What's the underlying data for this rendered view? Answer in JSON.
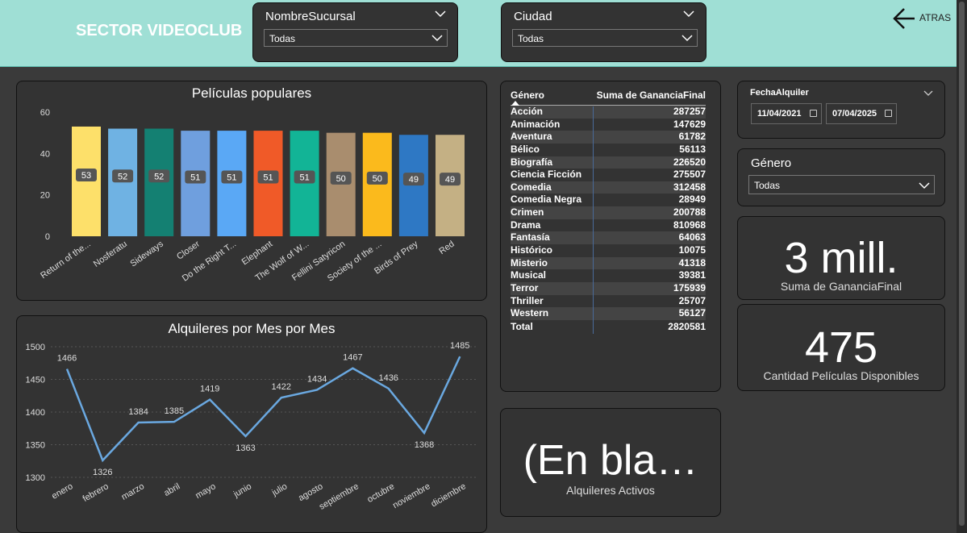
{
  "header": {
    "title": "SECTOR VIDEOCLUB",
    "back_label": "ATRAS"
  },
  "slicers": {
    "sucursal": {
      "label": "NombreSucursal",
      "value": "Todas"
    },
    "ciudad": {
      "label": "Ciudad",
      "value": "Todas"
    },
    "fecha": {
      "label": "FechaAlquiler",
      "start": "11/04/2021",
      "end": "07/04/2025"
    },
    "genero": {
      "label": "Género",
      "value": "Todas"
    }
  },
  "chart_data": [
    {
      "type": "bar",
      "title": "Películas populares",
      "categories": [
        "Return of the...",
        "Nosferatu",
        "Sideways",
        "Closer",
        "Do the Right T...",
        "Elephant",
        "The Wolf of W...",
        "Fellini Satyricon",
        "Society of the ...",
        "Birds of Prey",
        "Red"
      ],
      "values": [
        53,
        52,
        52,
        51,
        51,
        51,
        51,
        50,
        50,
        49,
        49
      ],
      "value_labels": [
        "53",
        "52",
        "52",
        "51",
        "51",
        "51",
        "51",
        "50",
        "50",
        "49",
        "49"
      ],
      "colors": [
        "#fde06a",
        "#6fb2e3",
        "#148072",
        "#6f9fde",
        "#5aa8f5",
        "#f05a28",
        "#12b496",
        "#a98d6e",
        "#fbba1c",
        "#2e78c4",
        "#c4b084"
      ],
      "ylim": [
        0,
        60
      ],
      "yticks": [
        "0",
        "20",
        "40",
        "60"
      ],
      "grid": false
    },
    {
      "type": "line",
      "title": "Alquileres por Mes por Mes",
      "categories": [
        "enero",
        "febrero",
        "marzo",
        "abril",
        "mayo",
        "junio",
        "julio",
        "agosto",
        "septiembre",
        "octubre",
        "noviembre",
        "diciembre"
      ],
      "values": [
        1466,
        1326,
        1384,
        1385,
        1419,
        1363,
        1422,
        1434,
        1467,
        1436,
        1368,
        1485
      ],
      "value_labels": [
        "1466",
        "1326",
        "1384",
        "1385",
        "1419",
        "1363",
        "1422",
        "1434",
        "1467",
        "1436",
        "1368",
        "1485"
      ],
      "ylim": [
        1300,
        1500
      ],
      "yticks": [
        "1300",
        "1350",
        "1400",
        "1450",
        "1500"
      ],
      "color": "#6aa8e0",
      "grid": true
    }
  ],
  "table": {
    "col1": "Género",
    "col2": "Suma de GananciaFinal",
    "rows": [
      {
        "genre": "Acción",
        "value": "287257"
      },
      {
        "genre": "Animación",
        "value": "147629"
      },
      {
        "genre": "Aventura",
        "value": "61782"
      },
      {
        "genre": "Bélico",
        "value": "56113"
      },
      {
        "genre": "Biografía",
        "value": "226520"
      },
      {
        "genre": "Ciencia Ficción",
        "value": "275507"
      },
      {
        "genre": "Comedia",
        "value": "312458"
      },
      {
        "genre": "Comedia Negra",
        "value": "28949"
      },
      {
        "genre": "Crimen",
        "value": "200788"
      },
      {
        "genre": "Drama",
        "value": "810968"
      },
      {
        "genre": "Fantasía",
        "value": "64063"
      },
      {
        "genre": "Histórico",
        "value": "10075"
      },
      {
        "genre": "Misterio",
        "value": "41318"
      },
      {
        "genre": "Musical",
        "value": "39381"
      },
      {
        "genre": "Terror",
        "value": "175939"
      },
      {
        "genre": "Thriller",
        "value": "25707"
      },
      {
        "genre": "Western",
        "value": "56127"
      }
    ],
    "total_label": "Total",
    "total_value": "2820581"
  },
  "cards": {
    "ganancia": {
      "value": "3 mill.",
      "label": "Suma de GananciaFinal"
    },
    "peliculas": {
      "value": "475",
      "label": "Cantidad Películas Disponibles"
    },
    "alquileres": {
      "value": "(En bla…",
      "label": "Alquileres Activos"
    }
  },
  "colors": {
    "header_bg": "#9fdfd5",
    "panel_bg": "#333333",
    "page_bg": "#3a3a3a"
  }
}
